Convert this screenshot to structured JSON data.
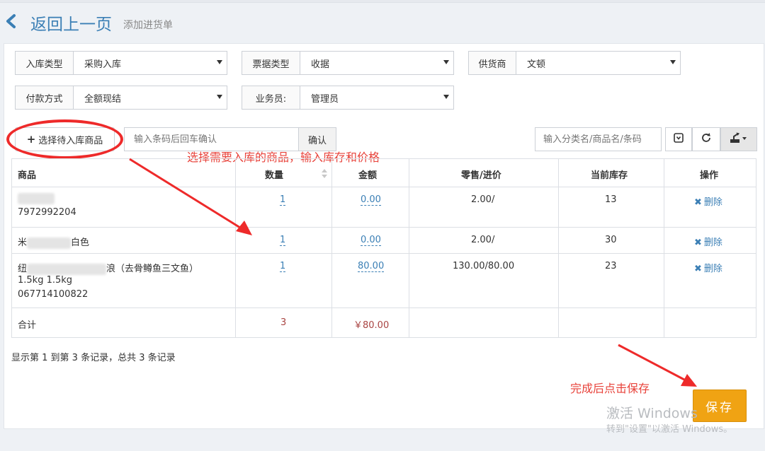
{
  "header": {
    "back_label": "返回上一页",
    "subtitle": "添加进货单"
  },
  "filters": {
    "stock_in_type": {
      "label": "入库类型",
      "value": "采购入库"
    },
    "receipt_type": {
      "label": "票据类型",
      "value": "收据"
    },
    "supplier": {
      "label": "供货商",
      "value": "文顿"
    },
    "payment_method": {
      "label": "付款方式",
      "value": "全额现结"
    },
    "salesperson": {
      "label": "业务员:",
      "value": "管理员"
    }
  },
  "toolbar": {
    "select_products_label": "选择待入库商品",
    "barcode_placeholder": "输入条码后回车确认",
    "confirm_label": "确认",
    "search_placeholder": "输入分类名/商品名/条码"
  },
  "annotations": {
    "hint_select": "选择需要入库的商品，输入库存和价格",
    "hint_save": "完成后点击保存",
    "color": "#e8423a"
  },
  "table": {
    "headers": [
      "商品",
      "数量",
      "金额",
      "零售/进价",
      "当前库存",
      "操作"
    ],
    "rows": [
      {
        "name_prefix": "",
        "name_suffix": "",
        "details": [
          "7972992204"
        ],
        "qty": "1",
        "amount": "0.00",
        "price": "2.00/",
        "stock": "13",
        "action": "删除"
      },
      {
        "name_prefix": "米",
        "name_suffix": "白色",
        "details": [],
        "qty": "1",
        "amount": "0.00",
        "price": "2.00/",
        "stock": "30",
        "action": "删除"
      },
      {
        "name_prefix": "纽",
        "name_suffix": "浪（去骨鳟鱼三文鱼）",
        "details": [
          "1.5kg 1.5kg",
          "067714100822"
        ],
        "qty": "1",
        "amount": "80.00",
        "price": "130.00/80.00",
        "stock": "23",
        "action": "删除"
      }
    ],
    "total": {
      "label": "合计",
      "qty": "3",
      "amount": "￥80.00"
    }
  },
  "record_info": "显示第 1 到第 3 条记录，总共 3 条记录",
  "save_label": "保存",
  "watermark": {
    "title": "激活 Windows",
    "subtitle": "转到\"设置\"以激活 Windows。"
  },
  "colors": {
    "link": "#3b7fb5",
    "save_button": "#f0a313",
    "total_red": "#a94442"
  },
  "icons": [
    "chevron-left-icon",
    "plus-icon",
    "toggle-icon",
    "refresh-icon",
    "export-icon",
    "close-icon"
  ]
}
